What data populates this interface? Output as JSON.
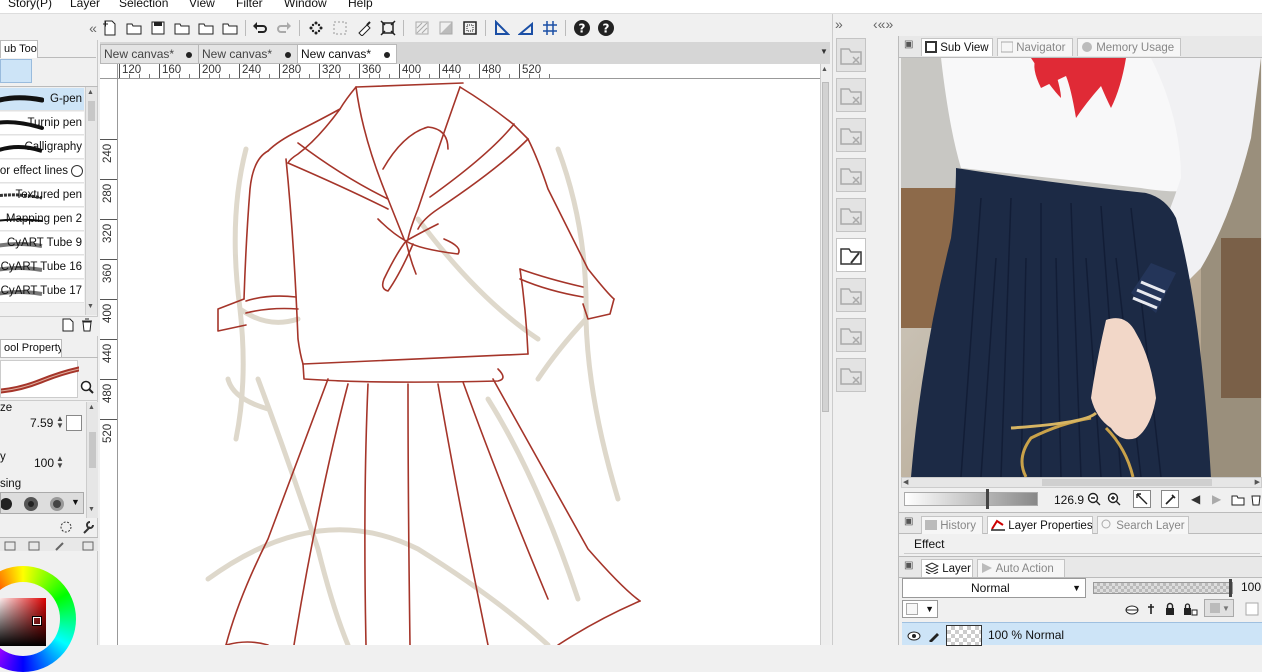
{
  "menu": {
    "story": "Story(P)",
    "layer": "Layer",
    "selection": "Selection",
    "view": "View",
    "filter": "Filter",
    "window": "Window",
    "help": "Help"
  },
  "left": {
    "sub_tool_tab": "ub Tool",
    "brushes": [
      "G-pen",
      "Turnip pen",
      "Calligraphy",
      "or effect lines",
      "Textured pen",
      "Mapping pen 2",
      "CyART Tube 9",
      "CyART Tube 16",
      "CyART Tube 17"
    ],
    "tool_property_tab": "ool Property",
    "size_label": "ze",
    "size_value": "7.59",
    "opacity_label": "y",
    "opacity_value": "100",
    "aa_label": "sing"
  },
  "tabs": [
    "New canvas*",
    "New canvas*",
    "New canvas*"
  ],
  "ruler": {
    "top": [
      "120",
      "160",
      "200",
      "240",
      "280",
      "320",
      "360",
      "400",
      "440",
      "480",
      "520"
    ],
    "left": [
      "240",
      "280",
      "320",
      "360",
      "400",
      "440",
      "480",
      "520"
    ]
  },
  "right": {
    "tab_subview": "Sub View",
    "tab_navigator": "Navigator",
    "tab_memory": "Memory Usage",
    "zoom": "126.9",
    "tab_history": "History",
    "tab_layer_props": "Layer Properties",
    "tab_search_layer": "Search Layer",
    "effect_label": "Effect",
    "tab_layer": "Layer",
    "tab_auto_action": "Auto Action",
    "blend_mode": "Normal",
    "opacity": "100",
    "layer_row_text": "100 %  Normal"
  },
  "colors": {
    "accent_select": "#cde4f7",
    "sketch_line": "#a5352a",
    "rough_line": "#d9d2c3",
    "skirt_navy": "#1c2a45",
    "scarf_red": "#e02a36"
  }
}
